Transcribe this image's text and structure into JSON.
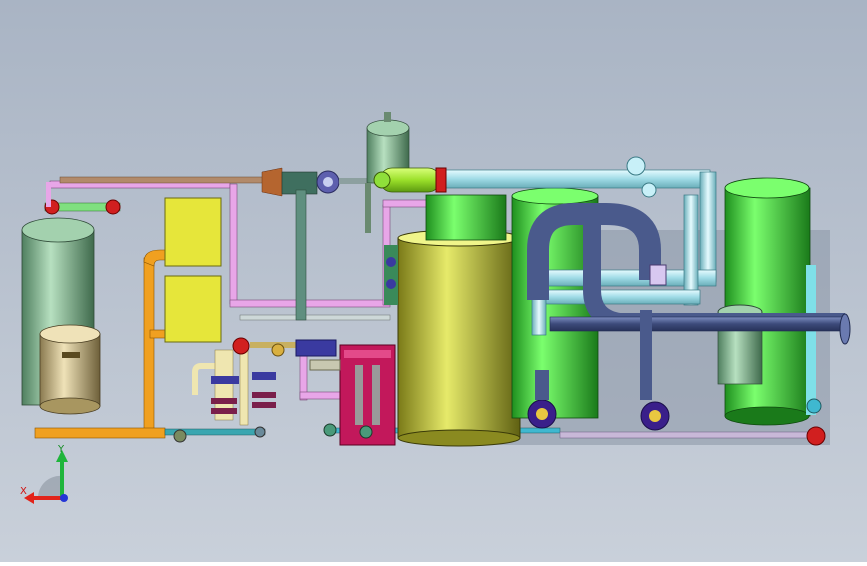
{
  "viewport": {
    "background_top": "#a9b4c4",
    "background_bottom": "#c9d0da"
  },
  "triad": {
    "x_label": "X",
    "y_label": "Y",
    "x_color": "#e2231a",
    "y_color": "#1fb53b",
    "z_color": "#2435d6"
  },
  "colors": {
    "vessel_green": "#3fd63f",
    "vessel_sage": "#7fbf8f",
    "vessel_olive": "#b9bf3a",
    "pipe_violet": "#e69be6",
    "pipe_cyan": "#aee6ef",
    "pipe_navy": "#4a5a8c",
    "pipe_orange": "#f0a020",
    "panel_yellow": "#e6e63a",
    "skid_magenta": "#c2185b",
    "valve_red": "#d11f1f"
  }
}
